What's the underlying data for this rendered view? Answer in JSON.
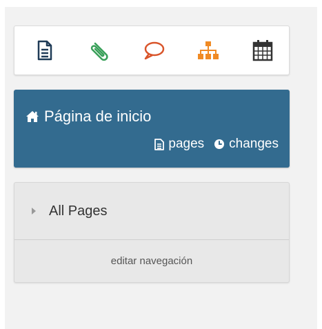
{
  "toolbar": {
    "items": [
      {
        "icon": "document-icon",
        "color": "#1f3b57"
      },
      {
        "icon": "paperclip-icon",
        "color": "#3aa05a"
      },
      {
        "icon": "comment-icon",
        "color": "#d9552b"
      },
      {
        "icon": "sitemap-icon",
        "color": "#f08a24"
      },
      {
        "icon": "calendar-icon",
        "color": "#333333"
      }
    ]
  },
  "home": {
    "title": "Página de inicio",
    "pages_label": "pages",
    "changes_label": "changes",
    "background": "#336b8f"
  },
  "navigation": {
    "items": [
      {
        "label": "All Pages"
      }
    ],
    "edit_label": "editar navegación"
  }
}
